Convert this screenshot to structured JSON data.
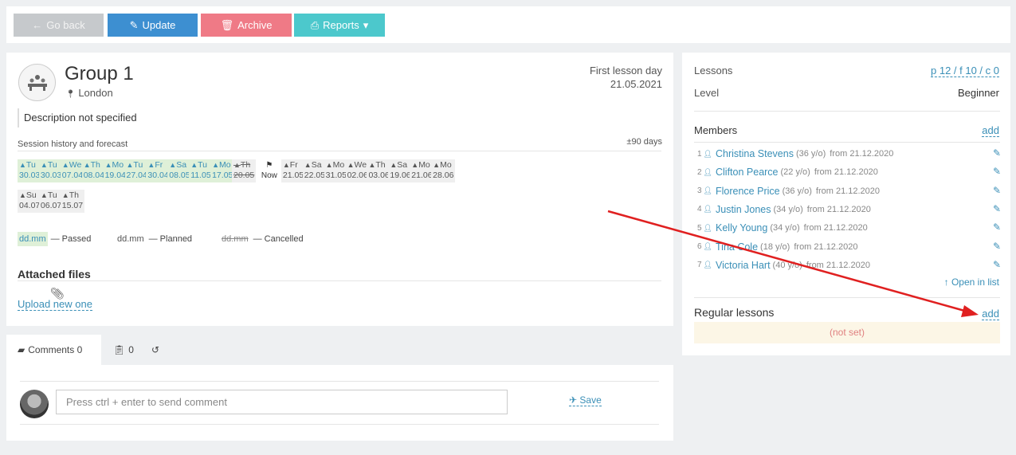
{
  "toolbar": {
    "back_label": "Go back",
    "update_label": "Update",
    "archive_label": "Archive",
    "reports_label": "Reports"
  },
  "group": {
    "title": "Group 1",
    "location": "London",
    "first_lesson_label": "First lesson day",
    "first_lesson_value": "21.05.2021",
    "description": "Description not specified"
  },
  "sessions": {
    "title": "Session history and forecast",
    "range": "±90 days",
    "now_label": "Now",
    "items": [
      {
        "day": "Tu",
        "date": "30.03",
        "status": "passed"
      },
      {
        "day": "Tu",
        "date": "30.03",
        "status": "passed"
      },
      {
        "day": "We",
        "date": "07.04",
        "status": "passed"
      },
      {
        "day": "Th",
        "date": "08.04",
        "status": "passed"
      },
      {
        "day": "Mo",
        "date": "19.04",
        "status": "passed"
      },
      {
        "day": "Tu",
        "date": "27.04",
        "status": "passed"
      },
      {
        "day": "Fr",
        "date": "30.04",
        "status": "passed"
      },
      {
        "day": "Sa",
        "date": "08.05",
        "status": "passed"
      },
      {
        "day": "Tu",
        "date": "11.05",
        "status": "passed"
      },
      {
        "day": "Mo",
        "date": "17.05",
        "status": "passed"
      },
      {
        "day": "Th",
        "date": "20.05",
        "status": "cancelled"
      },
      {
        "day": "Fr",
        "date": "21.05",
        "status": "planned"
      },
      {
        "day": "Sa",
        "date": "22.05",
        "status": "planned"
      },
      {
        "day": "Mo",
        "date": "31.05",
        "status": "planned"
      },
      {
        "day": "We",
        "date": "02.06",
        "status": "planned"
      },
      {
        "day": "Th",
        "date": "03.06",
        "status": "planned"
      },
      {
        "day": "Sa",
        "date": "19.06",
        "status": "planned"
      },
      {
        "day": "Mo",
        "date": "21.06",
        "status": "planned"
      },
      {
        "day": "Mo",
        "date": "28.06",
        "status": "planned"
      },
      {
        "day": "Su",
        "date": "04.07",
        "status": "planned"
      },
      {
        "day": "Tu",
        "date": "06.07",
        "status": "planned"
      },
      {
        "day": "Th",
        "date": "15.07",
        "status": "planned"
      }
    ]
  },
  "legend": {
    "sample": "dd.mm",
    "passed": "— Passed",
    "planned": "— Planned",
    "cancelled": "— Cancelled"
  },
  "attachments": {
    "title": "Attached files",
    "upload_label": "Upload new one"
  },
  "comments": {
    "tab_label": "Comments 0",
    "tab2_count": "0",
    "placeholder": "Press ctrl + enter to send comment",
    "save_label": "Save"
  },
  "side": {
    "lessons_label": "Lessons",
    "lessons_value": "p 12 / f 10 / c 0",
    "level_label": "Level",
    "level_value": "Beginner",
    "members_label": "Members",
    "members_add": "add",
    "members": [
      {
        "num": "1",
        "name": "Christina Stevens",
        "age": "(36 y/o)",
        "from": "from 21.12.2020"
      },
      {
        "num": "2",
        "name": "Clifton Pearce",
        "age": "(22 y/o)",
        "from": "from 21.12.2020"
      },
      {
        "num": "3",
        "name": "Florence Price",
        "age": "(36 y/o)",
        "from": "from 21.12.2020"
      },
      {
        "num": "4",
        "name": "Justin Jones",
        "age": "(34 y/o)",
        "from": "from 21.12.2020"
      },
      {
        "num": "5",
        "name": "Kelly Young",
        "age": "(34 y/o)",
        "from": "from 21.12.2020"
      },
      {
        "num": "6",
        "name": "Tina Cole",
        "age": "(18 y/o)",
        "from": "from 21.12.2020"
      },
      {
        "num": "7",
        "name": "Victoria Hart",
        "age": "(40 y/o)",
        "from": "from 21.12.2020"
      }
    ],
    "open_in_list": "Open in list",
    "regular_label": "Regular lessons",
    "regular_add": "add",
    "regular_value": "(not set)"
  },
  "colors": {
    "accent": "#3a8fb7",
    "update": "#3d8fd1",
    "archive": "#ef7a86",
    "reports": "#4cc8cc",
    "annotation_arrow": "#e02020"
  }
}
